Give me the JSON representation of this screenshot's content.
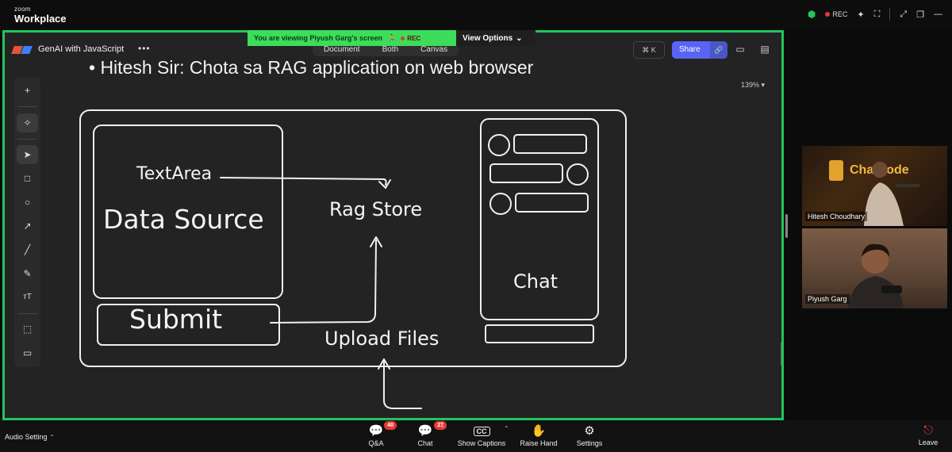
{
  "zoom": {
    "brand_small": "zoom",
    "brand_big": "Workplace",
    "rec_label": "REC"
  },
  "viewing_bar": {
    "text": "You are viewing  Piyush Garg's screen",
    "rec_label": "REC",
    "view_options": "View Options"
  },
  "app": {
    "title": "GenAI with JavaScript",
    "more": "•••",
    "tabs": [
      "Document",
      "Both",
      "Canvas"
    ],
    "shortcut": "⌘ K",
    "share_label": "Share"
  },
  "canvas": {
    "heading": "• Hitesh Sir: Chota sa RAG application on web browser",
    "zoom_level": "139% ▾",
    "labels": {
      "text_area": "TextArea",
      "data_source": "Data Source",
      "rag_store": "Rag Store",
      "submit": "Submit",
      "upload_files": "Upload Files",
      "chat": "Chat"
    }
  },
  "participants": [
    {
      "name": "Hitesh Choudhary",
      "bg_text": "ChaiCode"
    },
    {
      "name": "Piyush Garg"
    }
  ],
  "bottom": {
    "audio": "Audio Setting",
    "controls": [
      {
        "label": "Q&A",
        "icon": "qa-icon",
        "badge": "40"
      },
      {
        "label": "Chat",
        "icon": "chat-icon",
        "badge": "27"
      },
      {
        "label": "Show Captions",
        "icon": "captions-icon"
      },
      {
        "label": "Raise Hand",
        "icon": "hand-icon"
      },
      {
        "label": "Settings",
        "icon": "gear-icon"
      }
    ],
    "leave": "Leave"
  },
  "colors": {
    "share_border": "#22c55e",
    "share_button": "#5865f2",
    "canvas_bg": "#232323",
    "badge": "#e53935"
  }
}
